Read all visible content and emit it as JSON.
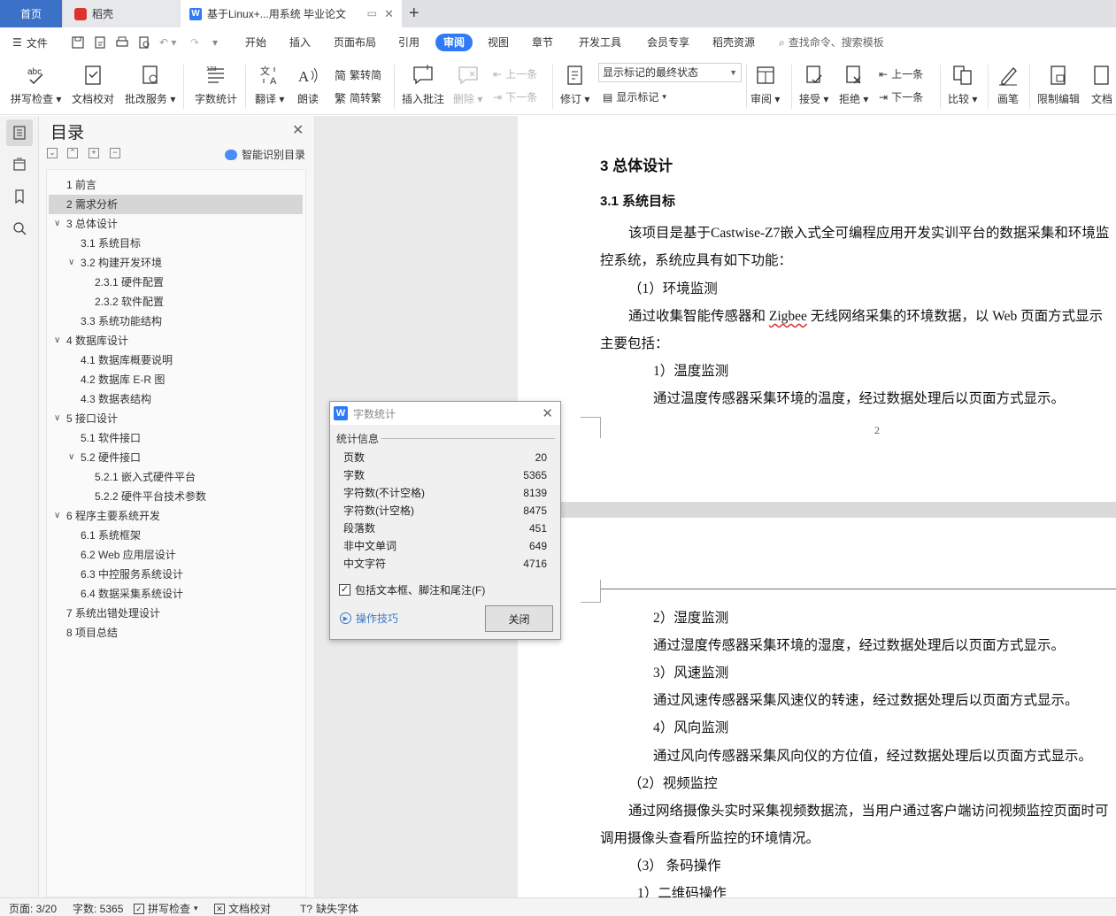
{
  "tabs": {
    "home": "首页",
    "daoke": "稻壳",
    "doc": "基于Linux+...用系统 毕业论文"
  },
  "menu": {
    "file": "文件",
    "items": [
      "开始",
      "插入",
      "页面布局",
      "引用",
      "审阅",
      "视图",
      "章节",
      "开发工具",
      "会员专享",
      "稻壳资源"
    ],
    "search": "查找命令、搜索模板"
  },
  "ribbon": {
    "spellcheck": "拼写检查",
    "proofread": "文档校对",
    "batch": "批改服务",
    "wordcount": "字数统计",
    "translate": "翻译",
    "read": "朗读",
    "to_traditional": "繁转简",
    "to_simplified": "简转繁",
    "insert_comment": "插入批注",
    "delete": "删除",
    "prev": "上一条",
    "next": "下一条",
    "revise": "修订",
    "markup_select": "显示标记的最终状态",
    "show_markup": "显示标记",
    "review": "审阅",
    "accept": "接受",
    "reject": "拒绝",
    "prev2": "上一条",
    "next2": "下一条",
    "compare": "比较",
    "pen": "画笔",
    "restrict": "限制编辑",
    "doc_more": "文档"
  },
  "toc": {
    "title": "目录",
    "smart": "智能识别目录",
    "items": [
      {
        "text": "1  前言",
        "level": 1,
        "chev": ""
      },
      {
        "text": "2  需求分析",
        "level": 1,
        "chev": "",
        "selected": true
      },
      {
        "text": "3  总体设计",
        "level": 1,
        "chev": "v"
      },
      {
        "text": "3.1  系统目标",
        "level": 2,
        "chev": ""
      },
      {
        "text": "3.2  构建开发环境",
        "level": 2,
        "chev": "v"
      },
      {
        "text": "2.3.1 硬件配置",
        "level": 3,
        "chev": ""
      },
      {
        "text": "2.3.2 软件配置",
        "level": 3,
        "chev": ""
      },
      {
        "text": "3.3  系统功能结构",
        "level": 2,
        "chev": ""
      },
      {
        "text": "4  数据库设计",
        "level": 1,
        "chev": "v"
      },
      {
        "text": "4.1  数据库概要说明",
        "level": 2,
        "chev": ""
      },
      {
        "text": "4.2  数据库 E-R 图",
        "level": 2,
        "chev": ""
      },
      {
        "text": "4.3  数据表结构",
        "level": 2,
        "chev": ""
      },
      {
        "text": "5  接口设计",
        "level": 1,
        "chev": "v"
      },
      {
        "text": "5.1 软件接口",
        "level": 2,
        "chev": ""
      },
      {
        "text": "5.2 硬件接口",
        "level": 2,
        "chev": "v"
      },
      {
        "text": "5.2.1  嵌入式硬件平台",
        "level": 3,
        "chev": ""
      },
      {
        "text": "5.2.2  硬件平台技术参数",
        "level": 3,
        "chev": ""
      },
      {
        "text": "6  程序主要系统开发",
        "level": 1,
        "chev": "v"
      },
      {
        "text": "6.1  系统框架",
        "level": 2,
        "chev": ""
      },
      {
        "text": "6.2 Web 应用层设计",
        "level": 2,
        "chev": ""
      },
      {
        "text": "6.3  中控服务系统设计",
        "level": 2,
        "chev": ""
      },
      {
        "text": "6.4  数据采集系统设计",
        "level": 2,
        "chev": ""
      },
      {
        "text": "7  系统出错处理设计",
        "level": 1,
        "chev": ""
      },
      {
        "text": "8  项目总结",
        "level": 1,
        "chev": ""
      }
    ]
  },
  "document": {
    "h1": "3  总体设计",
    "h2": "3.1  系统目标",
    "p1a": "该项目是基于Castwise-Z7嵌入式全可编程应用开发实训平台的数据采集和环境监",
    "p1b": "控系统，系统应具有如下功能：",
    "item1": "（1）环境监测",
    "p2a_pre": "通过收集智能传感器和 ",
    "p2a_word": "Zigbee",
    "p2a_post": " 无线网络采集的环境数据，以 Web 页面方式显示",
    "p2b": "主要包括：",
    "sub1": "1）温度监测",
    "sub1_text": "通过温度传感器采集环境的温度，经过数据处理后以页面方式显示。",
    "page_number": "2",
    "sub2": "2）湿度监测",
    "sub2_text": "通过湿度传感器采集环境的湿度，经过数据处理后以页面方式显示。",
    "sub3": "3）风速监测",
    "sub3_text": "通过风速传感器采集风速仪的转速，经过数据处理后以页面方式显示。",
    "sub4": "4）风向监测",
    "sub4_text": "通过风向传感器采集风向仪的方位值，经过数据处理后以页面方式显示。",
    "item2": "（2）视频监控",
    "p3a": "通过网络摄像头实时采集视频数据流，当用户通过客户端访问视频监控页面时可",
    "p3b": "调用摄像头查看所监控的环境情况。",
    "item3": "（3）  条码操作",
    "sub5": "1）二维码操作"
  },
  "dialog": {
    "title": "字数统计",
    "section": "统计信息",
    "rows": [
      {
        "label": "页数",
        "value": "20"
      },
      {
        "label": "字数",
        "value": "5365"
      },
      {
        "label": "字符数(不计空格)",
        "value": "8139"
      },
      {
        "label": "字符数(计空格)",
        "value": "8475"
      },
      {
        "label": "段落数",
        "value": "451"
      },
      {
        "label": "非中文单词",
        "value": "649"
      },
      {
        "label": "中文字符",
        "value": "4716"
      }
    ],
    "include_label": "包括文本框、脚注和尾注(F)",
    "include_checked": true,
    "tips": "操作技巧",
    "close": "关闭"
  },
  "status": {
    "page": "页面: 3/20",
    "words": "字数: 5365",
    "spellcheck": "拼写检查",
    "proofread": "文档校对",
    "missing_font": "缺失字体"
  },
  "colors": {
    "accent": "#2f7bf5",
    "home_tab": "#3b72c7",
    "wps_red": "#e0322d"
  }
}
